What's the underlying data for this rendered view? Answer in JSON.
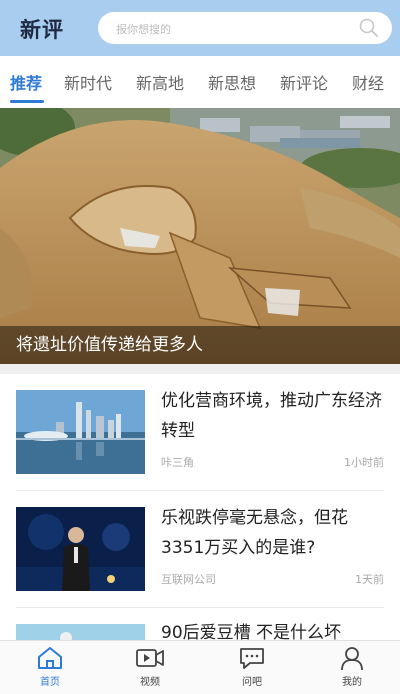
{
  "header": {
    "logo": "新评",
    "search_placeholder": "报你想搜的",
    "search_icon": "search-icon"
  },
  "tabs": [
    {
      "label": "推荐",
      "active": true
    },
    {
      "label": "新时代",
      "active": false
    },
    {
      "label": "新高地",
      "active": false
    },
    {
      "label": "新思想",
      "active": false
    },
    {
      "label": "新评论",
      "active": false
    },
    {
      "label": "财经",
      "active": false
    }
  ],
  "banner": {
    "caption": "将遗址价值传递给更多人"
  },
  "news": [
    {
      "title": "优化营商环境，推动广东经济转型",
      "source": "咔三角",
      "time": "1小时前"
    },
    {
      "title": "乐视跌停毫无悬念，但花3351万买入的是谁?",
      "source": "互联网公司",
      "time": "1天前"
    },
    {
      "title": "90后爱豆槽 不是什么坏",
      "source": "",
      "time": ""
    }
  ],
  "bottom_nav": [
    {
      "label": "首页",
      "icon": "home-icon",
      "active": true
    },
    {
      "label": "视频",
      "icon": "video-icon",
      "active": false
    },
    {
      "label": "问吧",
      "icon": "chat-icon",
      "active": false
    },
    {
      "label": "我的",
      "icon": "user-icon",
      "active": false
    }
  ],
  "colors": {
    "header_bg": "#a8cdee",
    "accent": "#2e7bd6"
  }
}
